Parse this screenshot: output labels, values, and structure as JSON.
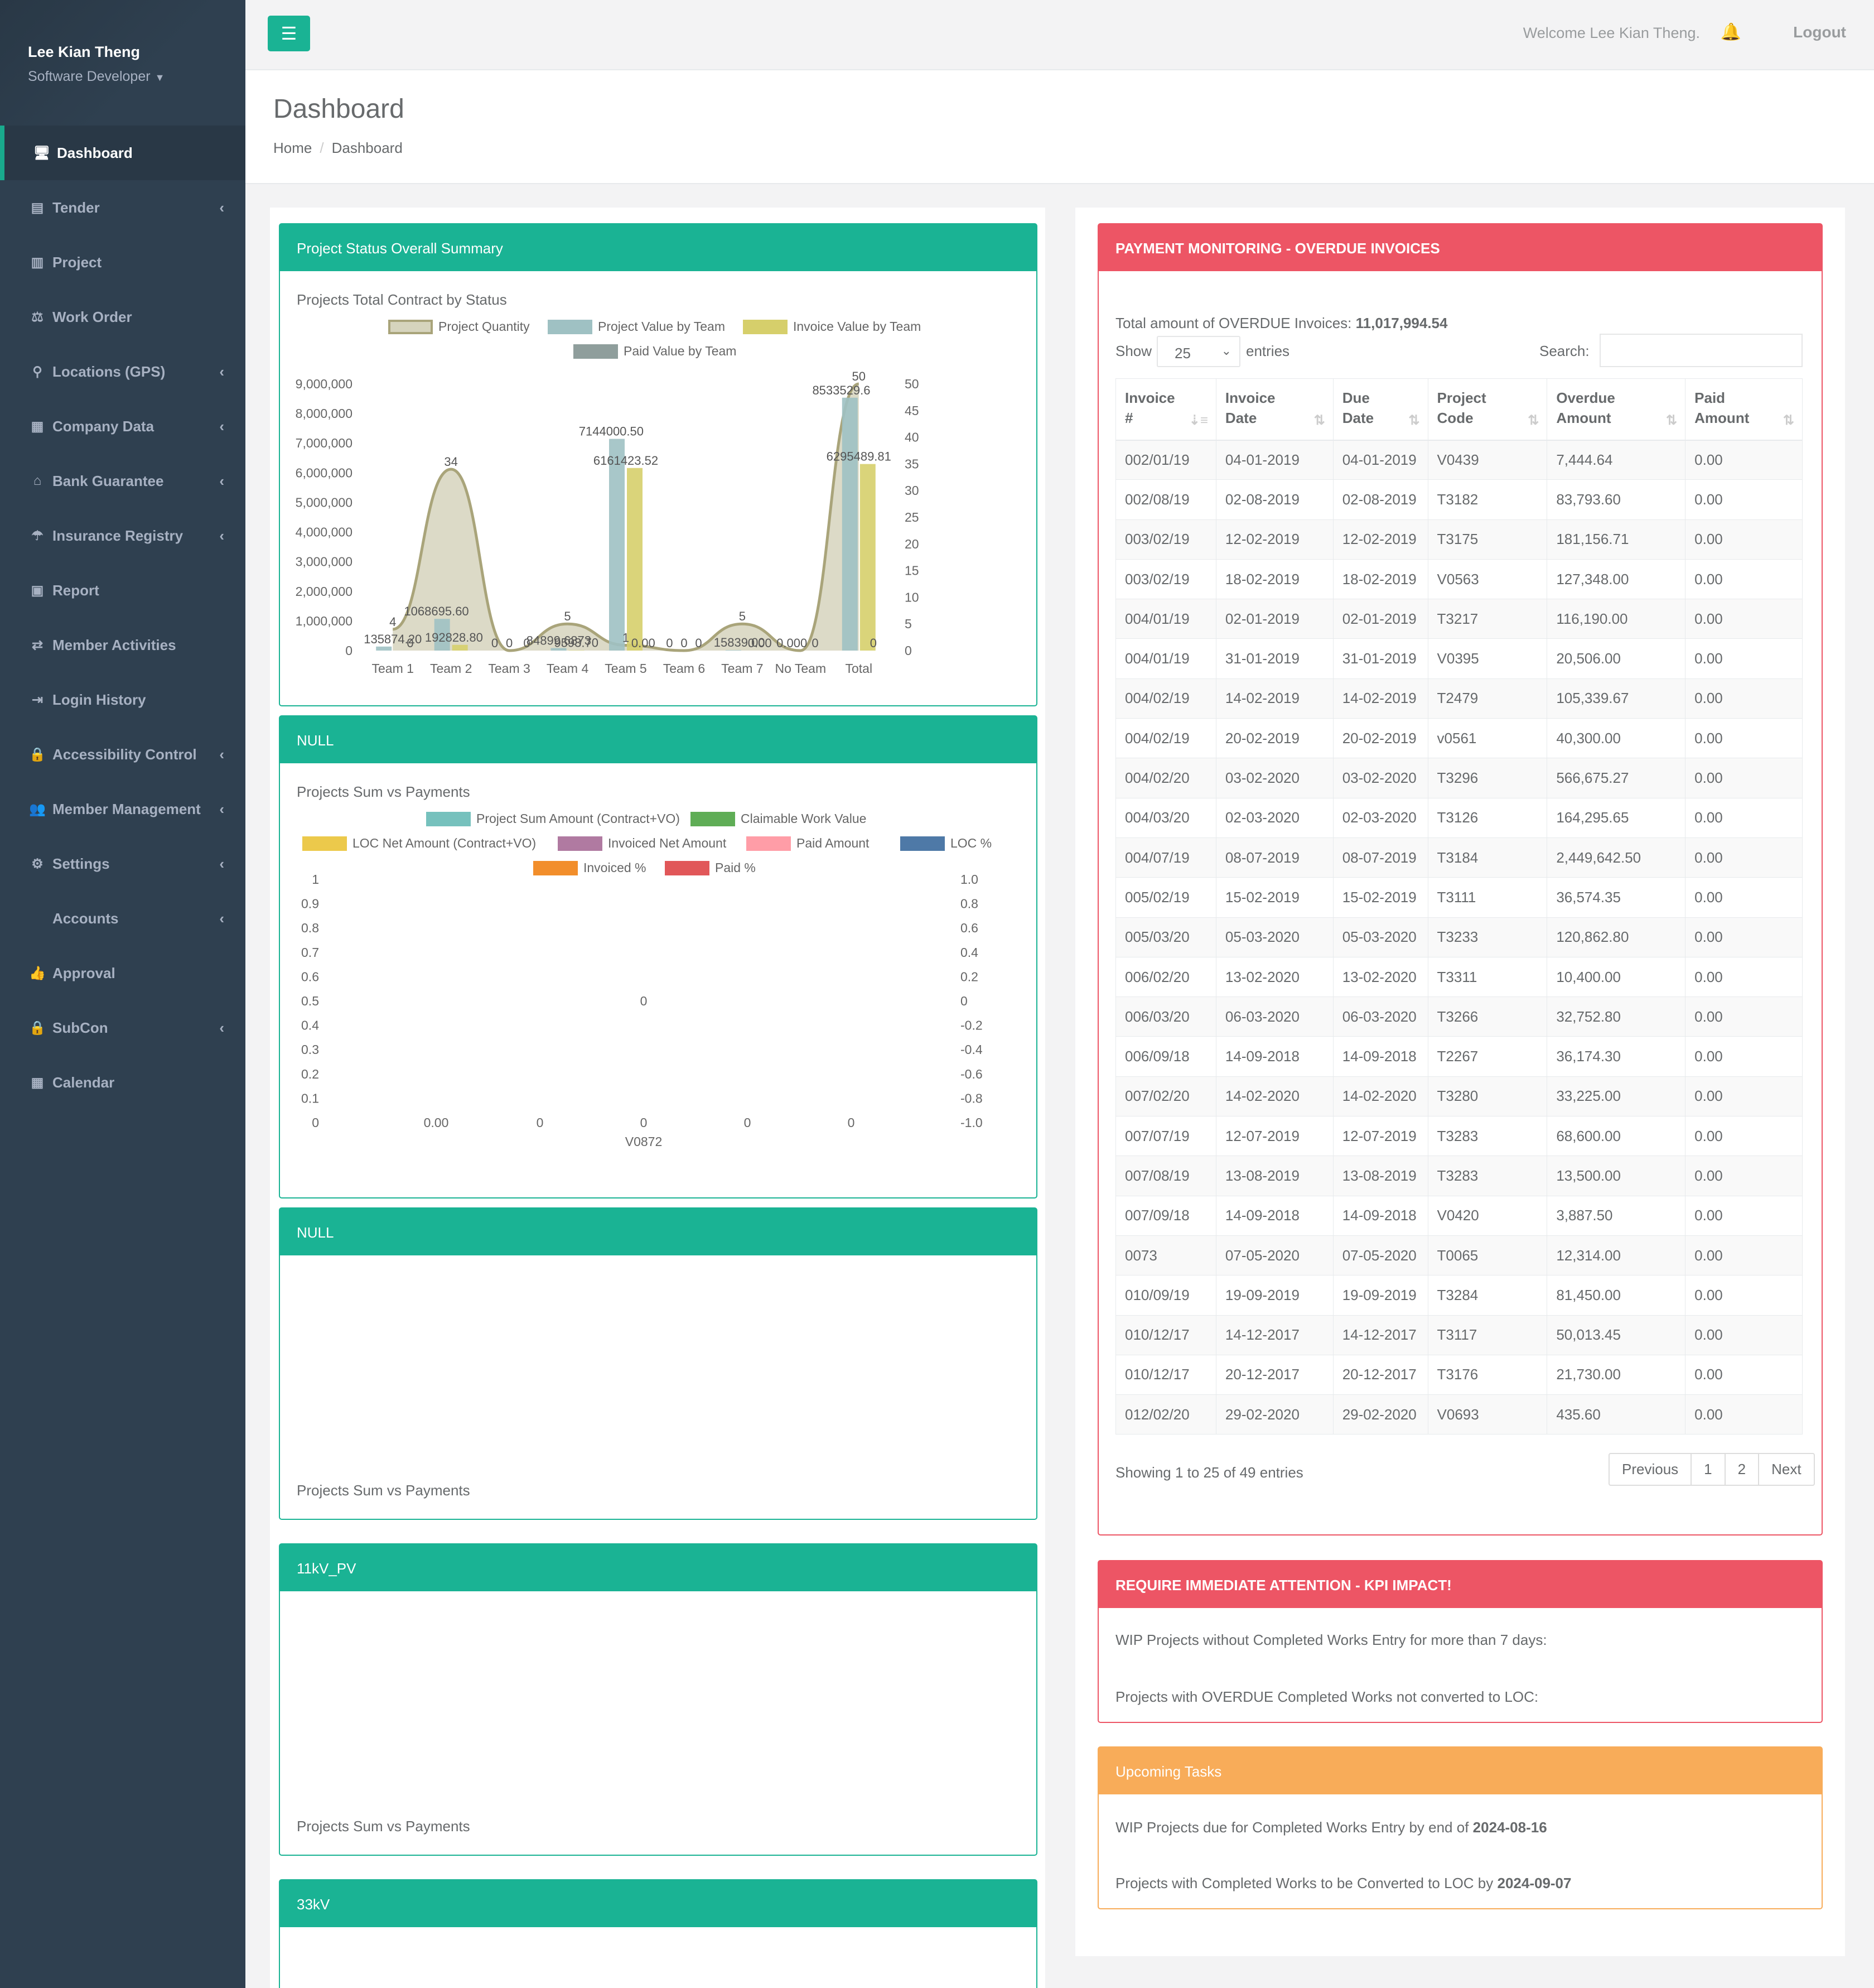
{
  "user": {
    "name": "Lee Kian Theng",
    "role": "Software Developer"
  },
  "sidebar": {
    "items": [
      {
        "label": "Dashboard",
        "icon": "desktop-icon",
        "glyph": "🖥",
        "arrow": ""
      },
      {
        "label": "Tender",
        "icon": "book-icon",
        "glyph": "▤",
        "arrow": "‹"
      },
      {
        "label": "Project",
        "icon": "bar-chart-icon",
        "glyph": "▥",
        "arrow": ""
      },
      {
        "label": "Work Order",
        "icon": "balance-scale-icon",
        "glyph": "⚖",
        "arrow": ""
      },
      {
        "label": "Locations (GPS)",
        "icon": "map-marker-icon",
        "glyph": "⚲",
        "arrow": "‹"
      },
      {
        "label": "Company Data",
        "icon": "building-icon",
        "glyph": "▦",
        "arrow": "‹"
      },
      {
        "label": "Bank Guarantee",
        "icon": "bank-icon",
        "glyph": "⌂",
        "arrow": "‹"
      },
      {
        "label": "Insurance Registry",
        "icon": "umbrella-icon",
        "glyph": "☂",
        "arrow": "‹"
      },
      {
        "label": "Report",
        "icon": "newspaper-icon",
        "glyph": "▣",
        "arrow": ""
      },
      {
        "label": "Member Activities",
        "icon": "exchange-icon",
        "glyph": "⇄",
        "arrow": ""
      },
      {
        "label": "Login History",
        "icon": "sign-in-icon",
        "glyph": "⇥",
        "arrow": ""
      },
      {
        "label": "Accessibility Control",
        "icon": "lock-icon",
        "glyph": "🔒",
        "arrow": "‹"
      },
      {
        "label": "Member Management",
        "icon": "users-icon",
        "glyph": "👥",
        "arrow": "‹"
      },
      {
        "label": "Settings",
        "icon": "gear-icon",
        "glyph": "⚙",
        "arrow": "‹"
      },
      {
        "label": "Accounts",
        "icon": "",
        "glyph": "",
        "arrow": "‹"
      },
      {
        "label": "Approval",
        "icon": "thumbs-up-icon",
        "glyph": "👍",
        "arrow": ""
      },
      {
        "label": "SubCon",
        "icon": "lock-icon",
        "glyph": "🔒",
        "arrow": "‹"
      },
      {
        "label": "Calendar",
        "icon": "calendar-icon",
        "glyph": "▦",
        "arrow": ""
      }
    ]
  },
  "topbar": {
    "welcome": "Welcome Lee Kian Theng.",
    "logout": "Logout"
  },
  "heading": {
    "title": "Dashboard",
    "crumb_home": "Home",
    "crumb_current": "Dashboard"
  },
  "panels": {
    "summary": {
      "title": "Project Status Overall Summary",
      "subtitle": "Projects Total Contract by Status"
    },
    "null1": {
      "title": "NULL",
      "subtitle": "Projects Sum vs Payments"
    },
    "null2": {
      "title": "NULL",
      "subtitle": "Projects Sum vs Payments"
    },
    "kv11": {
      "title": "11kV_PV",
      "subtitle": "Projects Sum vs Payments"
    },
    "kv33": {
      "title": "33kV"
    }
  },
  "chart_data": [
    {
      "type": "bar",
      "categories": [
        "Team 1",
        "Team 2",
        "Team 3",
        "Team 4",
        "Team 5",
        "Team 6",
        "Team 7",
        "No Team",
        "Total"
      ],
      "series": [
        {
          "name": "Project Quantity",
          "kind": "area",
          "axis": "right",
          "values": [
            4,
            34,
            0,
            5,
            1,
            0,
            5,
            0,
            50
          ]
        },
        {
          "name": "Project Value by Team",
          "kind": "bar",
          "values": [
            135874.2,
            1068695.6,
            0,
            84899.6873,
            7144000.5,
            0,
            15839.0,
            0,
            8533529.6
          ]
        },
        {
          "name": "Invoice Value by Team",
          "kind": "bar",
          "values": [
            0,
            192828.8,
            0,
            9593.7,
            6161423.52,
            0,
            0,
            0,
            6295489.81
          ]
        },
        {
          "name": "Paid Value by Team",
          "kind": "bar",
          "values": [
            0,
            0,
            0,
            0,
            0,
            0,
            0,
            0,
            0
          ]
        }
      ],
      "y_ticks": [
        "9,000,000",
        "8,000,000",
        "7,000,000",
        "6,000,000",
        "5,000,000",
        "4,000,000",
        "3,000,000",
        "2,000,000",
        "1,000,000",
        "0"
      ],
      "y2_ticks": [
        "50",
        "45",
        "40",
        "35",
        "30",
        "25",
        "20",
        "15",
        "10",
        "5",
        "0"
      ],
      "data_labels": [
        {
          "text": "4",
          "cat": 0,
          "val": 4,
          "axis": "right"
        },
        {
          "text": "135874.20",
          "cat": 0,
          "val": 135874.2
        },
        {
          "text": "0",
          "cat": 0.3,
          "val": 0
        },
        {
          "text": "34",
          "cat": 1,
          "val": 34,
          "axis": "right"
        },
        {
          "text": "1068695.60",
          "cat": 0.75,
          "val": 1068695.6
        },
        {
          "text": "192828.80",
          "cat": 1.05,
          "val": 192828.8
        },
        {
          "text": "0",
          "cat": 1.75,
          "val": 0
        },
        {
          "text": "0",
          "cat": 2,
          "val": 0
        },
        {
          "text": "0",
          "cat": 2.3,
          "val": 0
        },
        {
          "text": "5",
          "cat": 3,
          "val": 5,
          "axis": "right"
        },
        {
          "text": "84899.6873",
          "cat": 2.85,
          "val": 84899.6873
        },
        {
          "text": "9593.70",
          "cat": 3.15,
          "val": 9593.7
        },
        {
          "text": "7144000.50",
          "cat": 3.75,
          "val": 7144000.5
        },
        {
          "text": "6161423.52",
          "cat": 4,
          "val": 6161423.52
        },
        {
          "text": "1",
          "cat": 4,
          "val": 1,
          "axis": "right"
        },
        {
          "text": "0.00",
          "cat": 4.3,
          "val": 0
        },
        {
          "text": "0",
          "cat": 4.75,
          "val": 0
        },
        {
          "text": "0",
          "cat": 5,
          "val": 0
        },
        {
          "text": "0",
          "cat": 5.25,
          "val": 0
        },
        {
          "text": "5",
          "cat": 6,
          "val": 5,
          "axis": "right"
        },
        {
          "text": "15839.00",
          "cat": 5.95,
          "val": 15839
        },
        {
          "text": "0.00",
          "cat": 6.3,
          "val": 0
        },
        {
          "text": "0.000",
          "cat": 6.85,
          "val": 0
        },
        {
          "text": "0",
          "cat": 7.25,
          "val": 0
        },
        {
          "text": "50",
          "cat": 8,
          "val": 50,
          "axis": "right"
        },
        {
          "text": "8533529.6",
          "cat": 7.7,
          "val": 8533529.6
        },
        {
          "text": "6295489.81",
          "cat": 8,
          "val": 6295489.81
        },
        {
          "text": "0",
          "cat": 8.25,
          "val": 0
        }
      ]
    },
    {
      "type": "bar",
      "categories": [
        "V0872"
      ],
      "series": [
        {
          "name": "Project Sum Amount (Contract+VO)",
          "color": "#76c1bd",
          "values": [
            0
          ]
        },
        {
          "name": "Claimable Work Value",
          "color": "#5fad56",
          "values": [
            0
          ]
        },
        {
          "name": "LOC Net Amount (Contract+VO)",
          "color": "#ecc94b",
          "values": [
            0
          ]
        },
        {
          "name": "Invoiced Net Amount",
          "color": "#b07aa1",
          "values": [
            0
          ]
        },
        {
          "name": "Paid Amount",
          "color": "#ff9da7",
          "values": [
            0
          ]
        },
        {
          "name": "LOC %",
          "color": "#4e79a7",
          "values": [
            0
          ]
        },
        {
          "name": "Invoiced %",
          "color": "#f28e2b",
          "values": [
            0
          ]
        },
        {
          "name": "Paid %",
          "color": "#e15759",
          "values": [
            0
          ]
        }
      ],
      "y_ticks": [
        "1",
        "0.9",
        "0.8",
        "0.7",
        "0.6",
        "0.5",
        "0.4",
        "0.3",
        "0.2",
        "0.1",
        "0"
      ],
      "y2_ticks": [
        "1.0",
        "0.8",
        "0.6",
        "0.4",
        "0.2",
        "0",
        "-0.2",
        "-0.4",
        "-0.6",
        "-0.8",
        "-1.0"
      ],
      "bottom_labels": [
        "0.00",
        "0",
        "0",
        "0",
        "0"
      ],
      "center_label": "0"
    }
  ],
  "colors": {
    "area_fill": "#d6d4bd",
    "area_line": "#a9a47a",
    "bar_project": "#9fc1c3",
    "bar_invoice": "#d6cf6b",
    "bar_paid": "#8f9e9c"
  },
  "overdue": {
    "title": "PAYMENT MONITORING - OVERDUE INVOICES",
    "total_label": "Total amount of OVERDUE Invoices: ",
    "total_value": "11,017,994.54",
    "show_label": "Show",
    "entries_value": "25",
    "entries_label": "entries",
    "search_label": "Search:",
    "columns": [
      [
        "Invoice",
        "#"
      ],
      [
        "Invoice",
        "Date"
      ],
      [
        "Due",
        "Date"
      ],
      [
        "Project",
        "Code"
      ],
      [
        "Overdue",
        "Amount"
      ],
      [
        "Paid",
        "Amount"
      ]
    ],
    "rows": [
      [
        "002/01/19",
        "04-01-2019",
        "04-01-2019",
        "V0439",
        "7,444.64",
        "0.00"
      ],
      [
        "002/08/19",
        "02-08-2019",
        "02-08-2019",
        "T3182",
        "83,793.60",
        "0.00"
      ],
      [
        "003/02/19",
        "12-02-2019",
        "12-02-2019",
        "T3175",
        "181,156.71",
        "0.00"
      ],
      [
        "003/02/19",
        "18-02-2019",
        "18-02-2019",
        "V0563",
        "127,348.00",
        "0.00"
      ],
      [
        "004/01/19",
        "02-01-2019",
        "02-01-2019",
        "T3217",
        "116,190.00",
        "0.00"
      ],
      [
        "004/01/19",
        "31-01-2019",
        "31-01-2019",
        "V0395",
        "20,506.00",
        "0.00"
      ],
      [
        "004/02/19",
        "14-02-2019",
        "14-02-2019",
        "T2479",
        "105,339.67",
        "0.00"
      ],
      [
        "004/02/19",
        "20-02-2019",
        "20-02-2019",
        "v0561",
        "40,300.00",
        "0.00"
      ],
      [
        "004/02/20",
        "03-02-2020",
        "03-02-2020",
        "T3296",
        "566,675.27",
        "0.00"
      ],
      [
        "004/03/20",
        "02-03-2020",
        "02-03-2020",
        "T3126",
        "164,295.65",
        "0.00"
      ],
      [
        "004/07/19",
        "08-07-2019",
        "08-07-2019",
        "T3184",
        "2,449,642.50",
        "0.00"
      ],
      [
        "005/02/19",
        "15-02-2019",
        "15-02-2019",
        "T3111",
        "36,574.35",
        "0.00"
      ],
      [
        "005/03/20",
        "05-03-2020",
        "05-03-2020",
        "T3233",
        "120,862.80",
        "0.00"
      ],
      [
        "006/02/20",
        "13-02-2020",
        "13-02-2020",
        "T3311",
        "10,400.00",
        "0.00"
      ],
      [
        "006/03/20",
        "06-03-2020",
        "06-03-2020",
        "T3266",
        "32,752.80",
        "0.00"
      ],
      [
        "006/09/18",
        "14-09-2018",
        "14-09-2018",
        "T2267",
        "36,174.30",
        "0.00"
      ],
      [
        "007/02/20",
        "14-02-2020",
        "14-02-2020",
        "T3280",
        "33,225.00",
        "0.00"
      ],
      [
        "007/07/19",
        "12-07-2019",
        "12-07-2019",
        "T3283",
        "68,600.00",
        "0.00"
      ],
      [
        "007/08/19",
        "13-08-2019",
        "13-08-2019",
        "T3283",
        "13,500.00",
        "0.00"
      ],
      [
        "007/09/18",
        "14-09-2018",
        "14-09-2018",
        "V0420",
        "3,887.50",
        "0.00"
      ],
      [
        "0073",
        "07-05-2020",
        "07-05-2020",
        "T0065",
        "12,314.00",
        "0.00"
      ],
      [
        "010/09/19",
        "19-09-2019",
        "19-09-2019",
        "T3284",
        "81,450.00",
        "0.00"
      ],
      [
        "010/12/17",
        "14-12-2017",
        "14-12-2017",
        "T3117",
        "50,013.45",
        "0.00"
      ],
      [
        "010/12/17",
        "20-12-2017",
        "20-12-2017",
        "T3176",
        "21,730.00",
        "0.00"
      ],
      [
        "012/02/20",
        "29-02-2020",
        "29-02-2020",
        "V0693",
        "435.60",
        "0.00"
      ]
    ],
    "info": "Showing 1 to 25 of 49 entries",
    "pagination": [
      "Previous",
      "1",
      "2",
      "Next"
    ]
  },
  "attention": {
    "title": "REQUIRE IMMEDIATE ATTENTION - KPI IMPACT!",
    "line1": "WIP Projects without Completed Works Entry for more than 7 days:",
    "line2": "Projects with OVERDUE Completed Works not converted to LOC:"
  },
  "tasks": {
    "title": "Upcoming Tasks",
    "line1": "WIP Projects due for Completed Works Entry by end of ",
    "date1": "2024-08-16",
    "line2": "Projects with Completed Works to be Converted to LOC by ",
    "date2": "2024-09-07"
  }
}
